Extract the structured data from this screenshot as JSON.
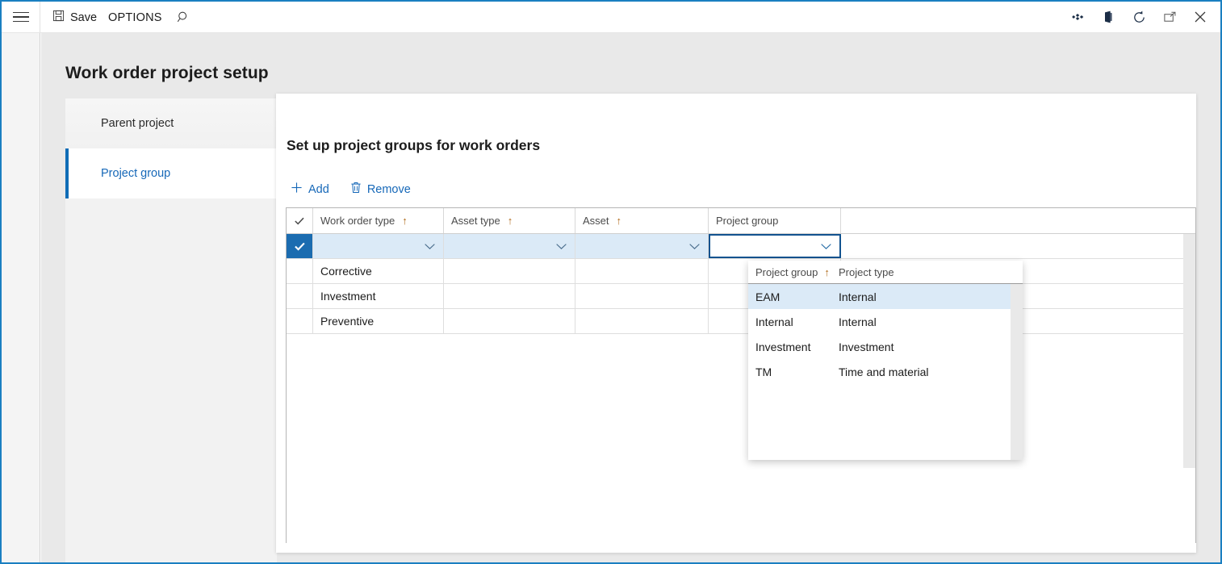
{
  "window": {
    "accent": "#0f6cb6",
    "border_color": "#1a7fc1"
  },
  "topbar": {
    "menu_icon": "hamburger-icon",
    "save_label": "Save",
    "save_icon": "save-disk-icon",
    "options_label": "OPTIONS",
    "search_icon": "search-icon",
    "right_icons": [
      {
        "name": "settings-gear-icon"
      },
      {
        "name": "office-app-icon"
      },
      {
        "name": "refresh-icon"
      },
      {
        "name": "popout-icon"
      },
      {
        "name": "close-icon"
      }
    ]
  },
  "page": {
    "title": "Work order project setup"
  },
  "sidebar": {
    "items": [
      {
        "label": "Parent project",
        "selected": false
      },
      {
        "label": "Project group",
        "selected": true
      }
    ]
  },
  "card": {
    "title": "Set up project groups for work orders",
    "toolbar": {
      "add_label": "Add",
      "add_icon": "plus-icon",
      "remove_label": "Remove",
      "remove_icon": "trash-icon"
    }
  },
  "grid": {
    "columns": [
      {
        "label": "",
        "icon": "check-icon",
        "sorted": false
      },
      {
        "label": "Work order type",
        "sorted": true,
        "sort_icon": "sort-ascending-arrow"
      },
      {
        "label": "Asset type",
        "sorted": true,
        "sort_icon": "sort-ascending-arrow"
      },
      {
        "label": "Asset",
        "sorted": true,
        "sort_icon": "sort-ascending-arrow"
      },
      {
        "label": "Project group",
        "sorted": false
      }
    ],
    "new_row": {
      "selected": true,
      "work_order_type": "",
      "asset_type": "",
      "asset": "",
      "project_group": "",
      "active_cell": "project_group"
    },
    "rows": [
      {
        "work_order_type": "Corrective",
        "asset_type": "",
        "asset": "",
        "project_group": ""
      },
      {
        "work_order_type": "Investment",
        "asset_type": "",
        "asset": "",
        "project_group": ""
      },
      {
        "work_order_type": "Preventive",
        "asset_type": "",
        "asset": "",
        "project_group": ""
      }
    ]
  },
  "lookup": {
    "columns": [
      {
        "label": "Project group",
        "sorted": true,
        "sort_icon": "sort-ascending-arrow"
      },
      {
        "label": "Project type",
        "sorted": false
      }
    ],
    "rows": [
      {
        "project_group": "EAM",
        "project_type": "Internal",
        "selected": true
      },
      {
        "project_group": "Internal",
        "project_type": "Internal",
        "selected": false
      },
      {
        "project_group": "Investment",
        "project_type": "Investment",
        "selected": false
      },
      {
        "project_group": "TM",
        "project_type": "Time and material",
        "selected": false
      }
    ]
  }
}
